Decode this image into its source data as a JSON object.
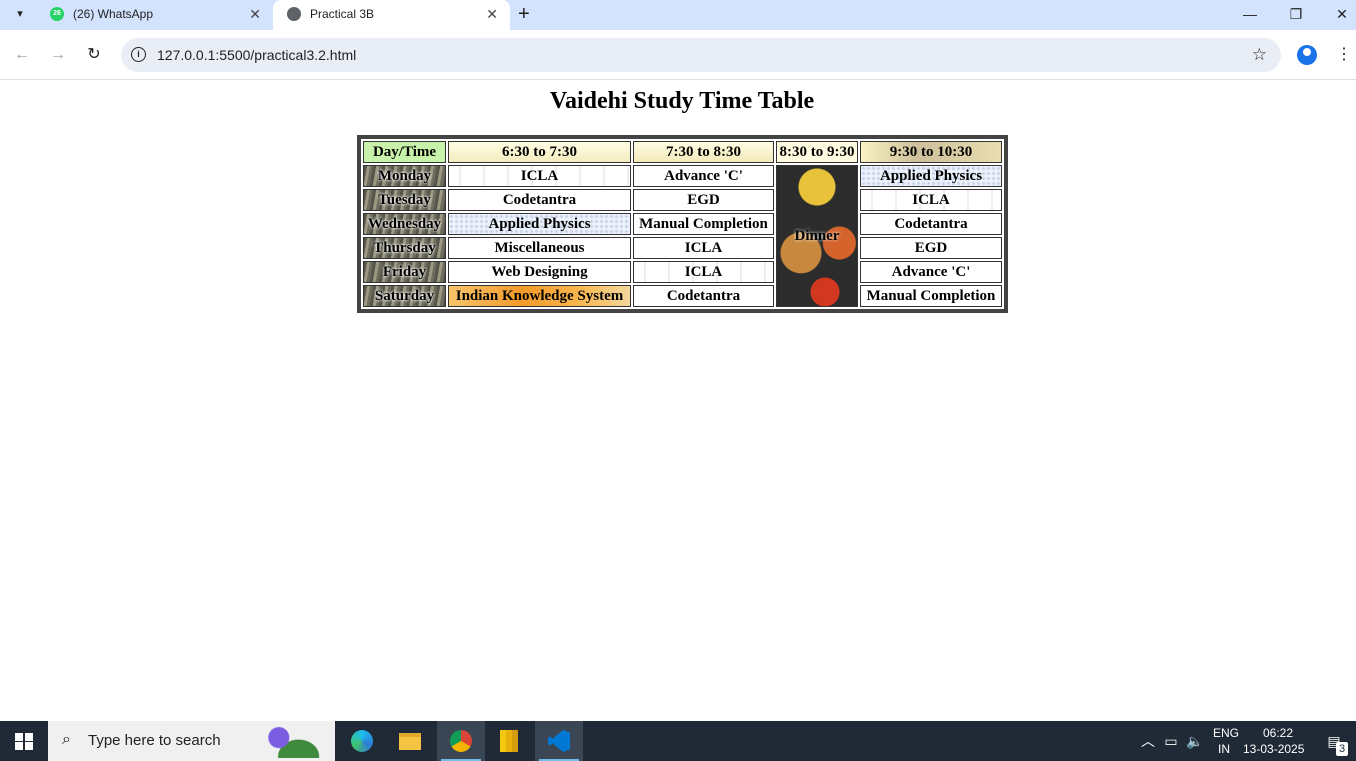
{
  "browser": {
    "tabs": [
      {
        "title": "(26) WhatsApp",
        "badge": "26",
        "icon": "whatsapp-icon"
      },
      {
        "title": "Practical 3B",
        "icon": "globe-icon",
        "active": true
      }
    ],
    "url": "127.0.0.1:5500/practical3.2.html"
  },
  "page": {
    "title": "Vaidehi Study Time Table",
    "header": [
      "Day/Time",
      "6:30 to 7:30",
      "7:30 to 8:30",
      "8:30 to 9:30",
      "9:30 to 10:30"
    ],
    "dinner_label": "Dinner",
    "rows": [
      {
        "day": "Monday",
        "s1": "ICLA",
        "s2": "Advance 'C'",
        "s4": "Applied Physics"
      },
      {
        "day": "Tuesday",
        "s1": "Codetantra",
        "s2": "EGD",
        "s4": "ICLA"
      },
      {
        "day": "Wednesday",
        "s1": "Applied Physics",
        "s2": "Manual Completion",
        "s4": "Codetantra"
      },
      {
        "day": "Thursday",
        "s1": "Miscellaneous",
        "s2": "ICLA",
        "s4": "EGD"
      },
      {
        "day": "Friday",
        "s1": "Web Designing",
        "s2": "ICLA",
        "s4": "Advance 'C'"
      },
      {
        "day": "Saturday",
        "s1": "Indian Knowledge System",
        "s2": "Codetantra",
        "s4": "Manual Completion"
      }
    ]
  },
  "taskbar": {
    "search_placeholder": "Type here to search",
    "language": "ENG",
    "region": "IN",
    "time": "06:22",
    "date": "13-03-2025",
    "notification_count": "3"
  },
  "colors": {
    "tabbar": "#d3e3fd",
    "taskbar": "#202a36",
    "header_day": "#c8f2a9"
  }
}
